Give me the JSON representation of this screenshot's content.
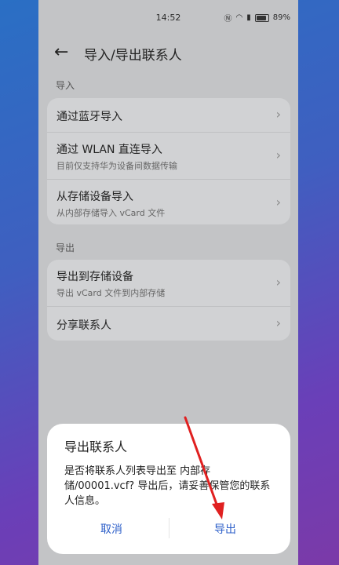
{
  "status": {
    "time": "14:52",
    "battery": "89%"
  },
  "header": {
    "title": "导入/导出联系人"
  },
  "import": {
    "label": "导入",
    "items": [
      {
        "title": "通过蓝牙导入",
        "subtitle": ""
      },
      {
        "title": "通过 WLAN 直连导入",
        "subtitle": "目前仅支持华为设备间数据传输"
      },
      {
        "title": "从存储设备导入",
        "subtitle": "从内部存储导入 vCard 文件"
      }
    ]
  },
  "export": {
    "label": "导出",
    "items": [
      {
        "title": "导出到存储设备",
        "subtitle": "导出 vCard 文件到内部存储"
      },
      {
        "title": "分享联系人",
        "subtitle": ""
      }
    ]
  },
  "dialog": {
    "title": "导出联系人",
    "message": "是否将联系人列表导出至 内部存储/00001.vcf? 导出后，请妥善保管您的联系人信息。",
    "cancel": "取消",
    "confirm": "导出"
  },
  "colors": {
    "accent": "#2d5fc9",
    "annotation_arrow": "#e02020"
  }
}
